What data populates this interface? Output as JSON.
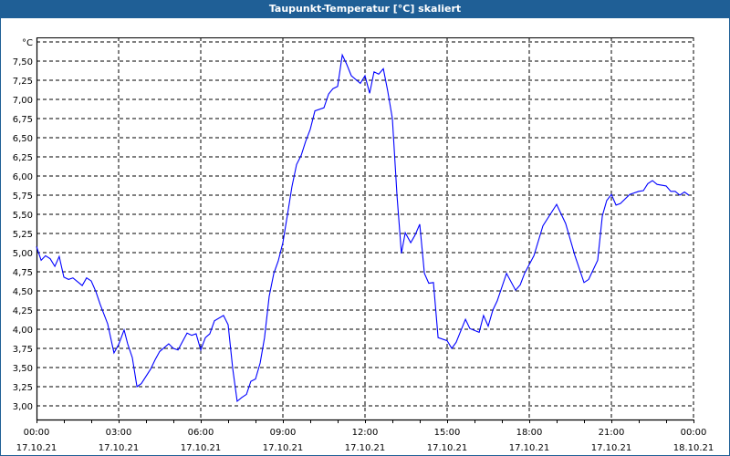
{
  "window": {
    "title": "Taupunkt-Temperatur [°C] skaliert"
  },
  "chart_data": {
    "type": "line",
    "title": "Taupunkt-Temperatur [°C] skaliert",
    "ylabel": "°C",
    "xlabel": "",
    "ylim": [
      2.8,
      7.8
    ],
    "xlim_hours": [
      0,
      24
    ],
    "grid": true,
    "y_ticks": [
      {
        "value": 3.0,
        "label": "3,00"
      },
      {
        "value": 3.25,
        "label": "3,25"
      },
      {
        "value": 3.5,
        "label": "3,50"
      },
      {
        "value": 3.75,
        "label": "3,75"
      },
      {
        "value": 4.0,
        "label": "4,00"
      },
      {
        "value": 4.25,
        "label": "4,25"
      },
      {
        "value": 4.5,
        "label": "4,50"
      },
      {
        "value": 4.75,
        "label": "4,75"
      },
      {
        "value": 5.0,
        "label": "5,00"
      },
      {
        "value": 5.25,
        "label": "5,25"
      },
      {
        "value": 5.5,
        "label": "5,50"
      },
      {
        "value": 5.75,
        "label": "5,75"
      },
      {
        "value": 6.0,
        "label": "6,00"
      },
      {
        "value": 6.25,
        "label": "6,25"
      },
      {
        "value": 6.5,
        "label": "6,50"
      },
      {
        "value": 6.75,
        "label": "6,75"
      },
      {
        "value": 7.0,
        "label": "7,00"
      },
      {
        "value": 7.25,
        "label": "7,25"
      },
      {
        "value": 7.5,
        "label": "7,50"
      },
      {
        "value": 7.75,
        "label": "°C"
      }
    ],
    "x_ticks": [
      {
        "hour": 0,
        "time": "00:00",
        "date": "17.10.21"
      },
      {
        "hour": 3,
        "time": "03:00",
        "date": "17.10.21"
      },
      {
        "hour": 6,
        "time": "06:00",
        "date": "17.10.21"
      },
      {
        "hour": 9,
        "time": "09:00",
        "date": "17.10.21"
      },
      {
        "hour": 12,
        "time": "12:00",
        "date": "17.10.21"
      },
      {
        "hour": 15,
        "time": "15:00",
        "date": "17.10.21"
      },
      {
        "hour": 18,
        "time": "18:00",
        "date": "17.10.21"
      },
      {
        "hour": 21,
        "time": "21:00",
        "date": "17.10.21"
      },
      {
        "hour": 24,
        "time": "00:00",
        "date": "18.10.21"
      }
    ],
    "series": [
      {
        "name": "Taupunkt",
        "color": "#0000ff",
        "x": [
          0,
          0.17,
          0.33,
          0.5,
          0.67,
          0.83,
          1.0,
          1.17,
          1.33,
          1.67,
          1.83,
          2.0,
          2.17,
          2.33,
          2.6,
          2.83,
          3.0,
          3.2,
          3.33,
          3.5,
          3.67,
          3.83,
          4.17,
          4.33,
          4.5,
          4.83,
          5.0,
          5.17,
          5.5,
          5.67,
          5.83,
          6.0,
          6.17,
          6.33,
          6.5,
          6.83,
          7.0,
          7.17,
          7.33,
          7.5,
          7.67,
          7.83,
          8.0,
          8.17,
          8.33,
          8.5,
          8.67,
          8.83,
          9.0,
          9.17,
          9.33,
          9.5,
          9.67,
          9.83,
          10.0,
          10.17,
          10.5,
          10.67,
          10.83,
          11.0,
          11.17,
          11.33,
          11.5,
          11.83,
          12.0,
          12.17,
          12.33,
          12.5,
          12.67,
          12.83,
          13.0,
          13.17,
          13.33,
          13.47,
          13.67,
          13.83,
          14.0,
          14.17,
          14.33,
          14.5,
          14.67,
          15.0,
          15.17,
          15.33,
          15.67,
          15.83,
          16.17,
          16.33,
          16.5,
          16.67,
          16.83,
          17.17,
          17.5,
          17.67,
          17.83,
          18.17,
          18.5,
          19.0,
          19.33,
          19.67,
          20.0,
          20.17,
          20.5,
          20.67,
          20.83,
          21.0,
          21.17,
          21.33,
          21.67,
          22.0,
          22.17,
          22.33,
          22.5,
          22.67,
          23.0,
          23.17,
          23.33,
          23.5,
          23.67,
          23.83
        ],
        "values": [
          5.08,
          4.9,
          4.96,
          4.92,
          4.82,
          4.95,
          4.68,
          4.65,
          4.67,
          4.57,
          4.67,
          4.63,
          4.49,
          4.32,
          4.07,
          3.69,
          3.8,
          3.99,
          3.81,
          3.63,
          3.25,
          3.29,
          3.48,
          3.6,
          3.71,
          3.81,
          3.75,
          3.73,
          3.95,
          3.92,
          3.94,
          3.73,
          3.89,
          3.94,
          4.11,
          4.18,
          4.06,
          3.48,
          3.06,
          3.11,
          3.15,
          3.32,
          3.35,
          3.56,
          3.89,
          4.43,
          4.73,
          4.89,
          5.13,
          5.5,
          5.86,
          6.15,
          6.27,
          6.45,
          6.61,
          6.85,
          6.89,
          7.07,
          7.14,
          7.17,
          7.58,
          7.46,
          7.31,
          7.21,
          7.31,
          7.08,
          7.36,
          7.33,
          7.4,
          7.11,
          6.75,
          5.74,
          4.99,
          5.26,
          5.13,
          5.23,
          5.37,
          4.73,
          4.6,
          4.61,
          3.89,
          3.85,
          3.75,
          3.83,
          4.13,
          4.01,
          3.96,
          4.18,
          4.04,
          4.25,
          4.37,
          4.73,
          4.51,
          4.58,
          4.73,
          4.96,
          5.35,
          5.63,
          5.38,
          4.96,
          4.61,
          4.65,
          4.9,
          5.48,
          5.68,
          5.76,
          5.62,
          5.64,
          5.76,
          5.8,
          5.81,
          5.9,
          5.94,
          5.89,
          5.87,
          5.8,
          5.8,
          5.75,
          5.79,
          5.75
        ]
      }
    ]
  }
}
